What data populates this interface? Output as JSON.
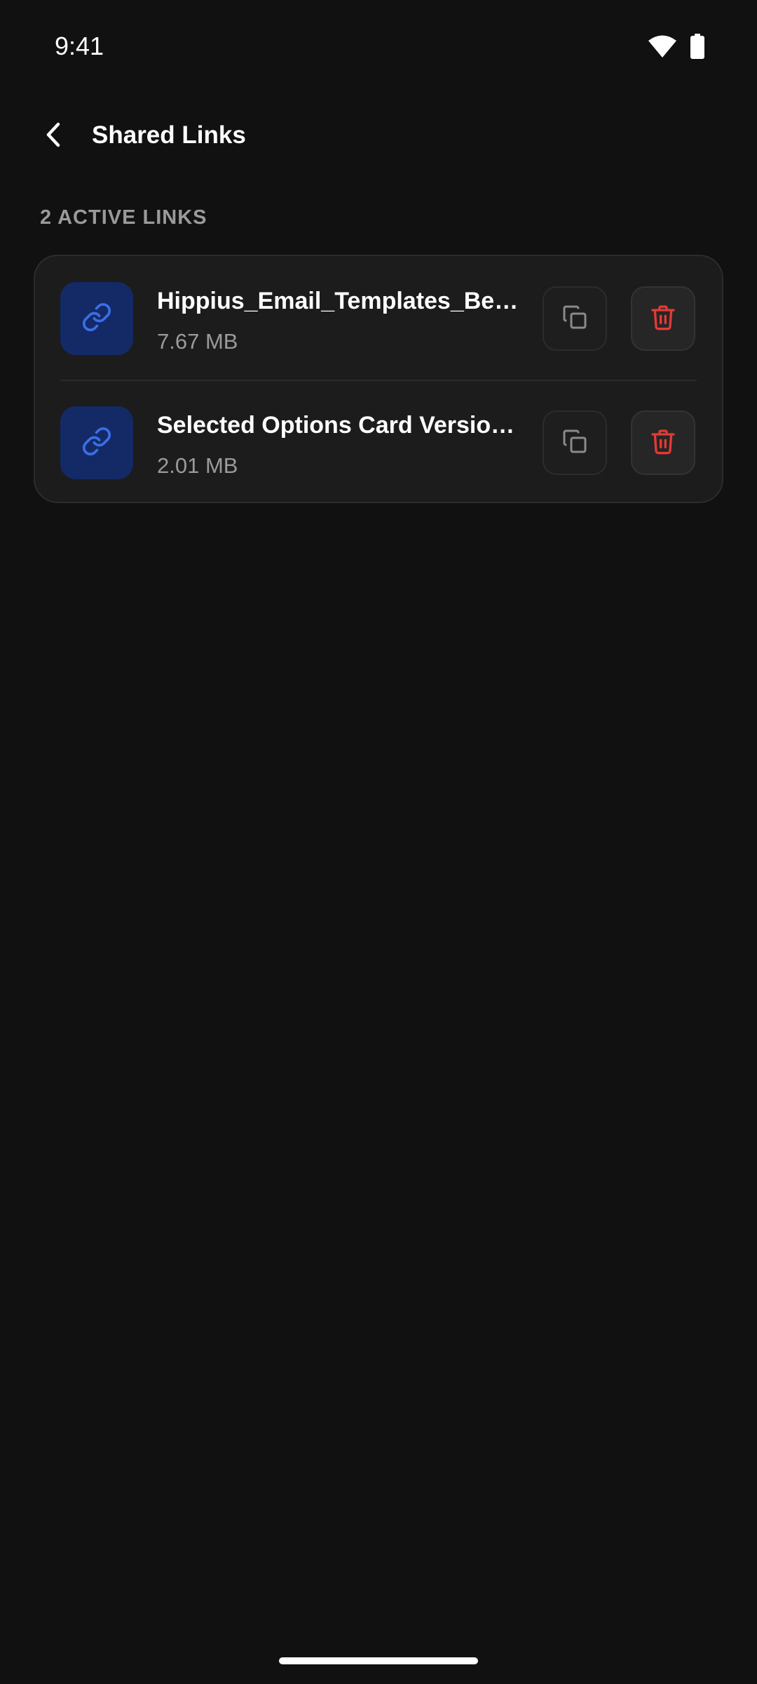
{
  "status_bar": {
    "time": "9:41",
    "icons": [
      "wifi-icon",
      "battery-icon"
    ]
  },
  "header": {
    "back_icon": "chevron-left-icon",
    "title": "Shared Links"
  },
  "section": {
    "label": "2 ACTIVE LINKS"
  },
  "links": [
    {
      "name": "Hippius_Email_Templates_Bef...",
      "size": "7.67 MB",
      "icon": "link-icon",
      "actions": [
        "copy-icon",
        "trash-icon"
      ]
    },
    {
      "name": "Selected Options Card Version...",
      "size": "2.01 MB",
      "icon": "link-icon",
      "actions": [
        "copy-icon",
        "trash-icon"
      ]
    }
  ],
  "colors": {
    "background": "#111111",
    "card": "#1c1c1c",
    "accent_blue": "#3a6ee8",
    "icon_box": "#142a66",
    "danger_red": "#e53935",
    "muted_text": "#9a9a9a"
  }
}
